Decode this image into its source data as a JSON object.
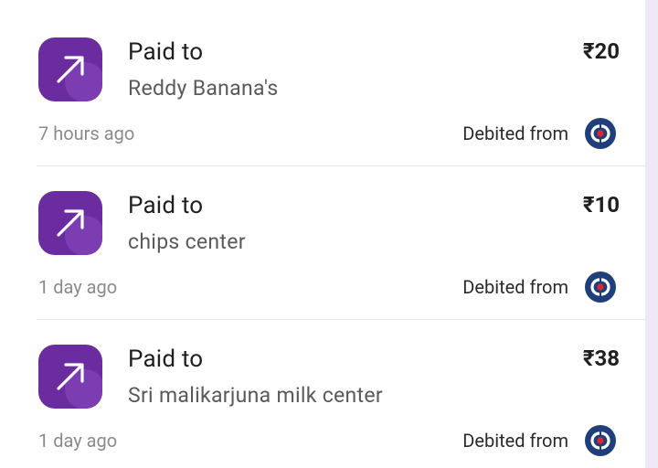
{
  "transactions": [
    {
      "label": "Paid to",
      "payee": "Reddy Banana's",
      "amount": "₹20",
      "time": "7 hours ago",
      "debited_label": "Debited from",
      "icon": "arrow-up-right-icon",
      "bank_icon": "kotak-bank-icon"
    },
    {
      "label": "Paid to",
      "payee": "chips center",
      "amount": "₹10",
      "time": "1 day ago",
      "debited_label": "Debited from",
      "icon": "arrow-up-right-icon",
      "bank_icon": "kotak-bank-icon"
    },
    {
      "label": "Paid to",
      "payee": "Sri malikarjuna milk center",
      "amount": "₹38",
      "time": "1 day ago",
      "debited_label": "Debited from",
      "icon": "arrow-up-right-icon",
      "bank_icon": "kotak-bank-icon"
    }
  ],
  "colors": {
    "icon_bg": "#6a2c9e",
    "background": "#efe9f7",
    "bank_logo_blue": "#1f3f7a",
    "bank_logo_red": "#e0262b"
  }
}
